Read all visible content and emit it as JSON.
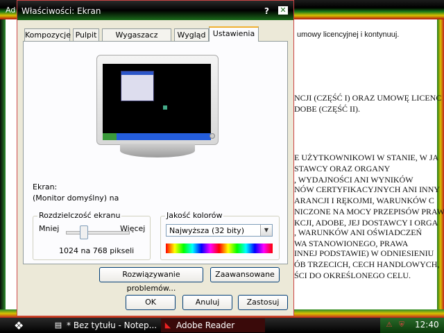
{
  "background_window": {
    "title_fragment": "Ad",
    "text_lines": [
      "umowy licencyjnej i kontynuuj.",
      "NCJI (CZĘŚĆ I) ORAZ UMOWĘ LICENC",
      "DOBE (CZĘŚĆ II).",
      "E UŻYTKOWNIKOWI W STANIE, W JA",
      "STAWCY ORAZ ORGANY",
      ", WYDAJNOŚCI ANI WYNIKÓW",
      "NÓW CERTYFIKACYJNYCH ANI INNY",
      "ARANCJI I RĘKOJMI, WARUNKÓW C",
      "NICZONE NA MOCY PRZEPISÓW PRAW",
      "KCJI, ADOBE, JEJ DOSTAWCY I ORGA",
      ", WARUNKÓW ANI OŚWIADCZEŃ",
      "WA STANOWIONEGO, PRAWA",
      "INNEJ PODSTAWIE) W ODNIESIENIU",
      "ÓB TRZECICH, CECH HANDLOWYCH,",
      "ŚCI DO OKREŚLONEGO CELU."
    ]
  },
  "dialog": {
    "title": "Właściwości: Ekran",
    "help_label": "?",
    "close_label": "✕",
    "tabs": [
      {
        "label": "Kompozycje"
      },
      {
        "label": "Pulpit"
      },
      {
        "label": "Wygaszacz ekranu"
      },
      {
        "label": "Wygląd"
      },
      {
        "label": "Ustawienia"
      }
    ],
    "active_tab": "Ustawienia",
    "display_label": "Ekran:",
    "display_value": "(Monitor domyślny) na",
    "resolution": {
      "legend": "Rozdzielczość ekranu",
      "less_label": "Mniej",
      "more_label": "Więcej",
      "value_text": "1024 na 768 pikseli",
      "slider_level": 0.25
    },
    "color_quality": {
      "legend": "Jakość kolorów",
      "selected": "Najwyższa (32 bity)"
    },
    "buttons": {
      "troubleshoot": "Rozwiązywanie problemów...",
      "advanced": "Zaawansowane",
      "ok": "OK",
      "cancel": "Anuluj",
      "apply": "Zastosuj"
    }
  },
  "taskbar": {
    "items": [
      {
        "label": "* Bez tytułu - Notep...",
        "icon": "notepad-icon"
      },
      {
        "label": "Adobe Reader",
        "icon": "adobe-reader-icon"
      }
    ],
    "clock": "12:40"
  }
}
